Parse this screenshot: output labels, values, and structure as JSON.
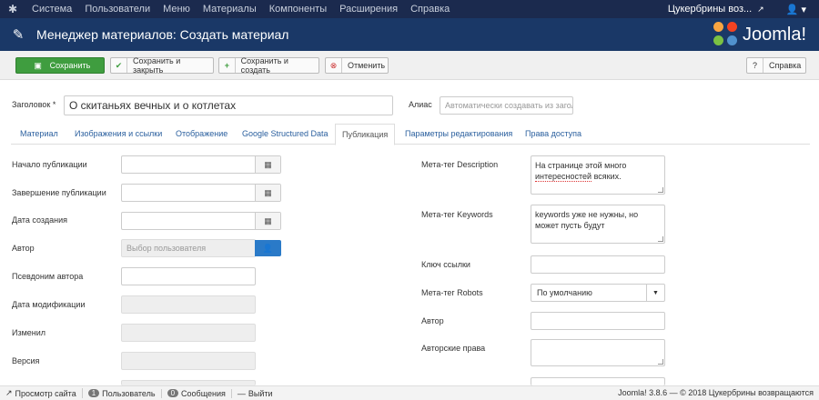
{
  "topnav": {
    "items": [
      "Система",
      "Пользователи",
      "Меню",
      "Материалы",
      "Компоненты",
      "Расширения",
      "Справка"
    ],
    "site_name": "Цукербрины воз...",
    "user_icon": "user-icon"
  },
  "header": {
    "title": "Менеджер материалов: Создать материал",
    "brand": "Joomla!"
  },
  "toolbar": {
    "save": "Сохранить",
    "save_close": "Сохранить и закрыть",
    "save_new": "Сохранить и создать",
    "cancel": "Отменить",
    "help": "Справка"
  },
  "form": {
    "title_label": "Заголовок *",
    "title_value": "О скитаньях вечных и о котлетах",
    "alias_label": "Алиас",
    "alias_placeholder": "Автоматически создавать из загол"
  },
  "tabs": [
    "Материал",
    "Изображения и ссылки",
    "Отображение",
    "Google Structured Data",
    "Публикация",
    "Параметры редактирования",
    "Права доступа"
  ],
  "active_tab": "Публикация",
  "left_fields": {
    "publish_up": "Начало публикации",
    "publish_down": "Завершение публикации",
    "created": "Дата создания",
    "author": "Автор",
    "author_placeholder": "Выбор пользователя",
    "author_alias": "Псевдоним автора",
    "modified": "Дата модификации",
    "modified_by": "Изменил",
    "version": "Версия"
  },
  "right_fields": {
    "meta_desc_label": "Мета-тег Description",
    "meta_desc_value_1": "На странице этой много",
    "meta_desc_value_2a": "интерeсностей",
    "meta_desc_value_2b": " всяких.",
    "meta_kw_label": "Мета-тег Keywords",
    "meta_kw_value": "keywords уже не нужны, но может пусть будут",
    "xreference_label": "Ключ ссылки",
    "robots_label": "Мета-тег Robots",
    "robots_value": "По умолчанию",
    "author_label": "Автор",
    "rights_label": "Авторские права"
  },
  "status": {
    "view_site": "Просмотр сайта",
    "users_count": "1",
    "users_label": "Пользователь",
    "messages_count": "0",
    "messages_label": "Сообщения",
    "logout": "Выйти",
    "footer": "Joomla! 3.8.6 — © 2018 Цукербрины возвращаются"
  },
  "colors": {
    "topnav": "#1b2a4e",
    "header": "#1a3867",
    "save_green": "#3f9d3f",
    "link_blue": "#2a5f9e",
    "user_btn": "#2a7ac8"
  }
}
